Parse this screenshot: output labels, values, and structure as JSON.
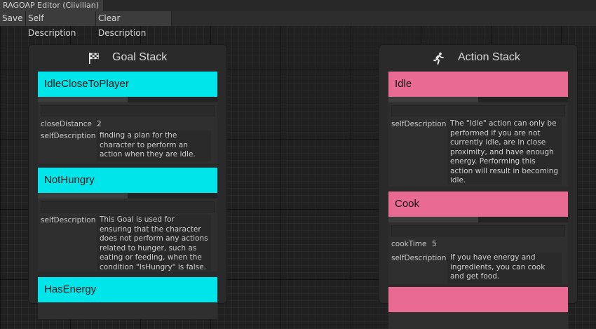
{
  "window": {
    "title": "RAGOAP Editor (Ciivilian)"
  },
  "toolbar": {
    "save": "Save",
    "self_description": "Self Description",
    "clear_description": "Clear Description"
  },
  "goal_stack": {
    "title": "Goal Stack",
    "icon": "checkered-flag-icon",
    "cards": [
      {
        "name": "IdleCloseToPlayer",
        "color": "#00e5ea",
        "props": [
          {
            "label": "closeDistance",
            "value": "2"
          },
          {
            "label": "selfDescription",
            "value": "finding a plan for the character to perform an action when they are idle."
          }
        ]
      },
      {
        "name": "NotHungry",
        "color": "#00e5ea",
        "props": [
          {
            "label": "selfDescription",
            "value": "This Goal is used for ensuring that the character does not perform any actions related to hunger, such as eating or feeding, when the condition \"IsHungry\" is false."
          }
        ]
      },
      {
        "name": "HasEnergy",
        "color": "#00e5ea",
        "props": []
      }
    ]
  },
  "action_stack": {
    "title": "Action Stack",
    "icon": "running-person-icon",
    "cards": [
      {
        "name": "Idle",
        "color": "#e96a92",
        "props": [
          {
            "label": "selfDescription",
            "value": "The \"Idle\" action can only be performed if you are not currently idle, are in close proximity, and have enough energy. Performing this action will result in becoming idle."
          }
        ]
      },
      {
        "name": "Cook",
        "color": "#e96a92",
        "props": [
          {
            "label": "cookTime",
            "value": "5"
          },
          {
            "label": "selfDescription",
            "value": "If you have energy and ingredients, you can cook and get food."
          }
        ]
      },
      {
        "name": "",
        "color": "#e96a92",
        "props": []
      }
    ]
  }
}
